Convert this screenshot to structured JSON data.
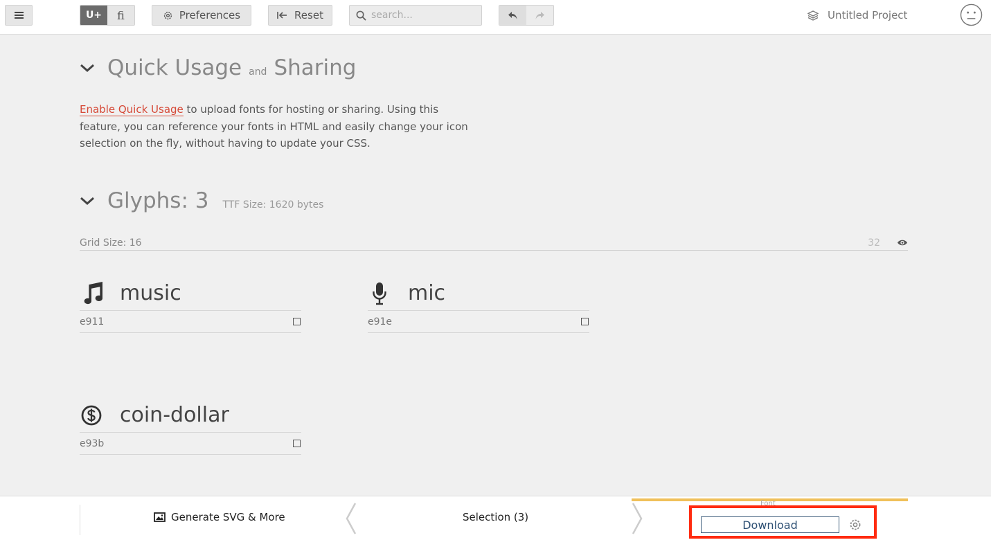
{
  "toolbar": {
    "unicode_toggle": "U+",
    "ligature_toggle": "ﬁ",
    "preferences_label": "Preferences",
    "reset_label": "Reset",
    "search_placeholder": "search...",
    "project_name": "Untitled Project"
  },
  "quick_usage": {
    "title_part1": "Quick Usage",
    "title_and": "and",
    "title_part2": "Sharing",
    "link_text": "Enable Quick Usage",
    "description": " to upload fonts for hosting or sharing. Using this feature, you can reference your fonts in HTML and easily change your icon selection on the fly, without having to update your CSS."
  },
  "glyphs": {
    "title": "Glyphs: 3",
    "ttf_size": "TTF Size: 1620 bytes",
    "grid_size_label": "Grid Size: 16",
    "grid_value": "32",
    "items": [
      {
        "name": "music",
        "code": "e911",
        "icon": "music-icon"
      },
      {
        "name": "mic",
        "code": "e91e",
        "icon": "mic-icon"
      },
      {
        "name": "coin-dollar",
        "code": "e93b",
        "icon": "coin-dollar-icon"
      }
    ]
  },
  "bottom": {
    "generate_label": "Generate SVG & More",
    "selection_label": "Selection (3)",
    "font_label": "Font",
    "download_label": "Download"
  },
  "colors": {
    "accent_link": "#d64937",
    "font_tab_accent": "#f0c05a",
    "highlight": "#ff2b10"
  }
}
